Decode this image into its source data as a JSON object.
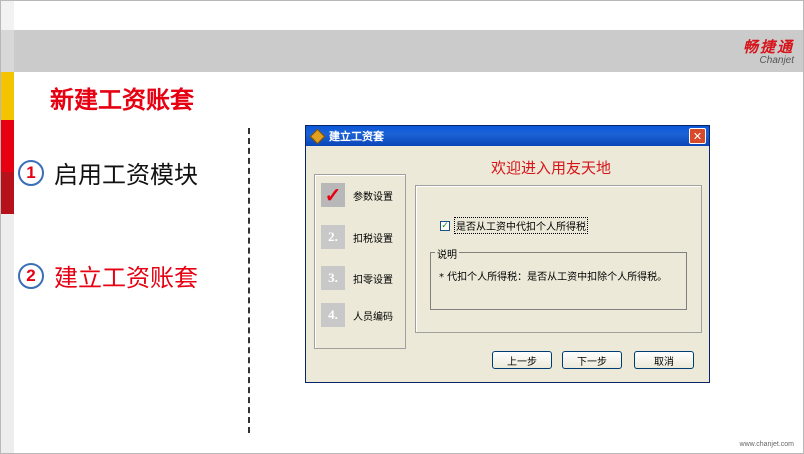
{
  "brand": {
    "name_cn": "畅捷通",
    "name_en": "Chanjet"
  },
  "slide_title": "新建工资账套",
  "steps": [
    {
      "num": "1",
      "text": "启用工资模块"
    },
    {
      "num": "2",
      "text": "建立工资账套"
    }
  ],
  "dialog": {
    "title": "建立工资套",
    "close_label": "✕",
    "welcome": "欢迎进入用友天地",
    "nav": [
      {
        "badge": "✓",
        "label": "参数设置"
      },
      {
        "badge": "2.",
        "label": "扣税设置"
      },
      {
        "badge": "3.",
        "label": "扣零设置"
      },
      {
        "badge": "4.",
        "label": "人员编码"
      }
    ],
    "checkbox_label": "是否从工资中代扣个人所得税",
    "checkbox_mark": "✓",
    "desc_legend": "说明",
    "desc_text": "* 代扣个人所得税：是否从工资中扣除个人所得税。",
    "buttons": {
      "prev": "上一步",
      "next": "下一步",
      "cancel": "取消"
    }
  },
  "footer_url": "www.chanjet.com",
  "colors": {
    "accent_red": "#e60012",
    "strip_yellow": "#f5c400",
    "strip_red": "#d7141a"
  }
}
